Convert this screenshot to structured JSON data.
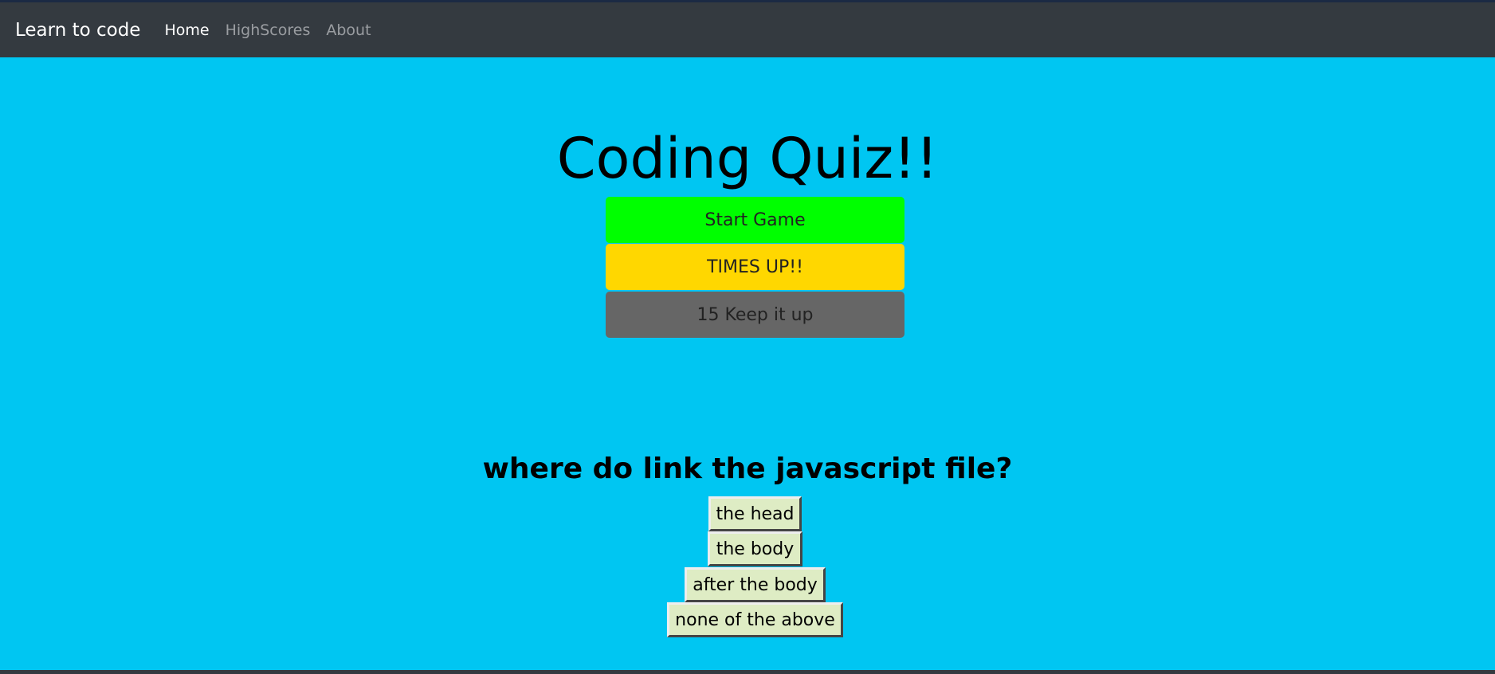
{
  "navbar": {
    "brand": "Learn to code",
    "links": [
      {
        "label": "Home",
        "active": true
      },
      {
        "label": "HighScores"
      },
      {
        "label": "About"
      }
    ]
  },
  "main": {
    "title": "Coding Quiz!!",
    "start_button": "Start Game",
    "status_button": "TIMES UP!!",
    "score_button": "15 Keep it up",
    "colors": {
      "background": "#00c6f2",
      "start": "#00ff00",
      "status": "#ffd700",
      "score": "#666666",
      "answer": "#deecc4"
    }
  },
  "quiz": {
    "question": "where do link the javascript file?",
    "answers": [
      "the head",
      "the body",
      "after the body",
      "none of the above"
    ]
  }
}
